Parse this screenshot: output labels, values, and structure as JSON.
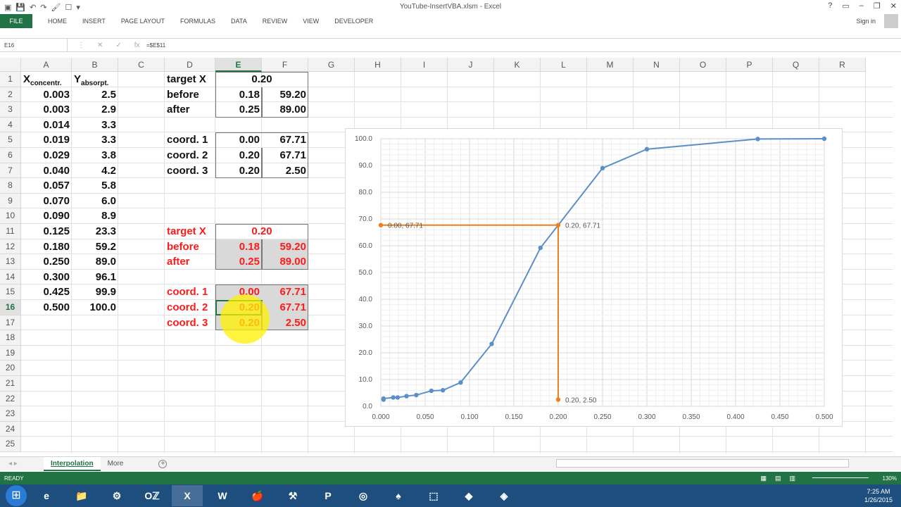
{
  "window": {
    "title": "YouTube-InsertVBA.xlsm - Excel",
    "buttons": [
      "?",
      "▭",
      "–",
      "❐",
      "✕"
    ],
    "qat": [
      "▣",
      "💾",
      "↶",
      "↷",
      "🖌",
      "☐",
      "▾"
    ]
  },
  "ribbon": {
    "file": "FILE",
    "tabs": [
      "HOME",
      "INSERT",
      "PAGE LAYOUT",
      "FORMULAS",
      "DATA",
      "REVIEW",
      "VIEW",
      "DEVELOPER"
    ],
    "signin": "Sign in"
  },
  "formula_bar": {
    "name_box": "E16",
    "icons": [
      "⋮",
      "✕",
      "✓",
      "fx"
    ],
    "formula": "=$E$11"
  },
  "grid": {
    "columns": [
      "A",
      "B",
      "C",
      "D",
      "E",
      "F",
      "G",
      "H",
      "I",
      "J",
      "K",
      "L",
      "M",
      "N",
      "O",
      "P",
      "Q",
      "R"
    ],
    "rows": [
      "1",
      "2",
      "3",
      "4",
      "5",
      "6",
      "7",
      "8",
      "9",
      "10",
      "11",
      "12",
      "13",
      "14",
      "15",
      "16",
      "17",
      "18",
      "19",
      "20",
      "21",
      "22",
      "23",
      "24",
      "25"
    ],
    "active_col": "E",
    "active_row": "16",
    "headers": {
      "x_main": "X",
      "x_sub": "concentr.",
      "y_main": "Y",
      "y_sub": "absorpt."
    },
    "col_a": [
      "0.003",
      "0.003",
      "0.014",
      "0.019",
      "0.029",
      "0.040",
      "0.057",
      "0.070",
      "0.090",
      "0.125",
      "0.180",
      "0.250",
      "0.300",
      "0.425",
      "0.500"
    ],
    "col_b": [
      "2.5",
      "2.9",
      "3.3",
      "3.3",
      "3.8",
      "4.2",
      "5.8",
      "6.0",
      "8.9",
      "23.3",
      "59.2",
      "89.0",
      "96.1",
      "99.9",
      "100.0"
    ],
    "top_block": {
      "labels": [
        "target X",
        "before",
        "after",
        "coord. 1",
        "coord. 2",
        "coord. 3"
      ],
      "target_x": "0.20",
      "before": [
        "0.18",
        "59.20"
      ],
      "after": [
        "0.25",
        "89.00"
      ],
      "coord1": [
        "0.00",
        "67.71"
      ],
      "coord2": [
        "0.20",
        "67.71"
      ],
      "coord3": [
        "0.20",
        "2.50"
      ]
    },
    "bottom_block": {
      "labels": [
        "target X",
        "before",
        "after",
        "coord. 1",
        "coord. 2",
        "coord. 3"
      ],
      "target_x": "0.20",
      "before": [
        "0.18",
        "59.20"
      ],
      "after": [
        "0.25",
        "89.00"
      ],
      "coord1": [
        "0.00",
        "67.71"
      ],
      "coord2": [
        "0.20",
        "67.71"
      ],
      "coord3": [
        "0.20",
        "2.50"
      ]
    }
  },
  "chart_data": {
    "type": "scatter",
    "title": "",
    "xlabel": "",
    "ylabel": "",
    "xlim": [
      0,
      0.5
    ],
    "ylim": [
      0,
      100
    ],
    "x_ticks": [
      "0.000",
      "0.050",
      "0.100",
      "0.150",
      "0.200",
      "0.250",
      "0.300",
      "0.350",
      "0.400",
      "0.450",
      "0.500"
    ],
    "y_ticks": [
      "0.0",
      "10.0",
      "20.0",
      "30.0",
      "40.0",
      "50.0",
      "60.0",
      "70.0",
      "80.0",
      "90.0",
      "100.0"
    ],
    "grid": true,
    "series": [
      {
        "color": "#5b8fc7",
        "x": [
          0.003,
          0.003,
          0.014,
          0.019,
          0.029,
          0.04,
          0.057,
          0.07,
          0.09,
          0.125,
          0.18,
          0.25,
          0.3,
          0.425,
          0.5
        ],
        "y": [
          2.5,
          2.9,
          3.3,
          3.3,
          3.8,
          4.2,
          5.8,
          6.0,
          8.9,
          23.3,
          59.2,
          89.0,
          96.1,
          99.9,
          100.0
        ]
      },
      {
        "color": "#f07f1e",
        "x": [
          0.0,
          0.2,
          0.2
        ],
        "y": [
          67.71,
          67.71,
          2.5
        ],
        "labels": [
          "0.00, 67.71",
          "0.20, 67.71",
          "0.20, 2.50"
        ]
      }
    ]
  },
  "sheets": {
    "tabs": [
      "Interpolation",
      "More"
    ],
    "active": "Interpolation",
    "add": "+",
    "nav": "◂ ▸"
  },
  "status": {
    "ready": "READY",
    "zoom": "130%",
    "views": [
      "▦",
      "▤",
      "▥"
    ]
  },
  "taskbar": {
    "apps": [
      "e",
      "📁",
      "⚙",
      "Oℤ",
      "X",
      "W",
      "🍎",
      "⚒",
      "P",
      "◎",
      "♠",
      "⬚",
      "◆",
      "◈"
    ],
    "time": "7:25 AM",
    "date": "1/26/2015"
  },
  "colors": {
    "excel_green": "#217346",
    "red_text": "#ff1a1a",
    "series_blue": "#5b8fc7",
    "series_orange": "#f07f1e"
  }
}
